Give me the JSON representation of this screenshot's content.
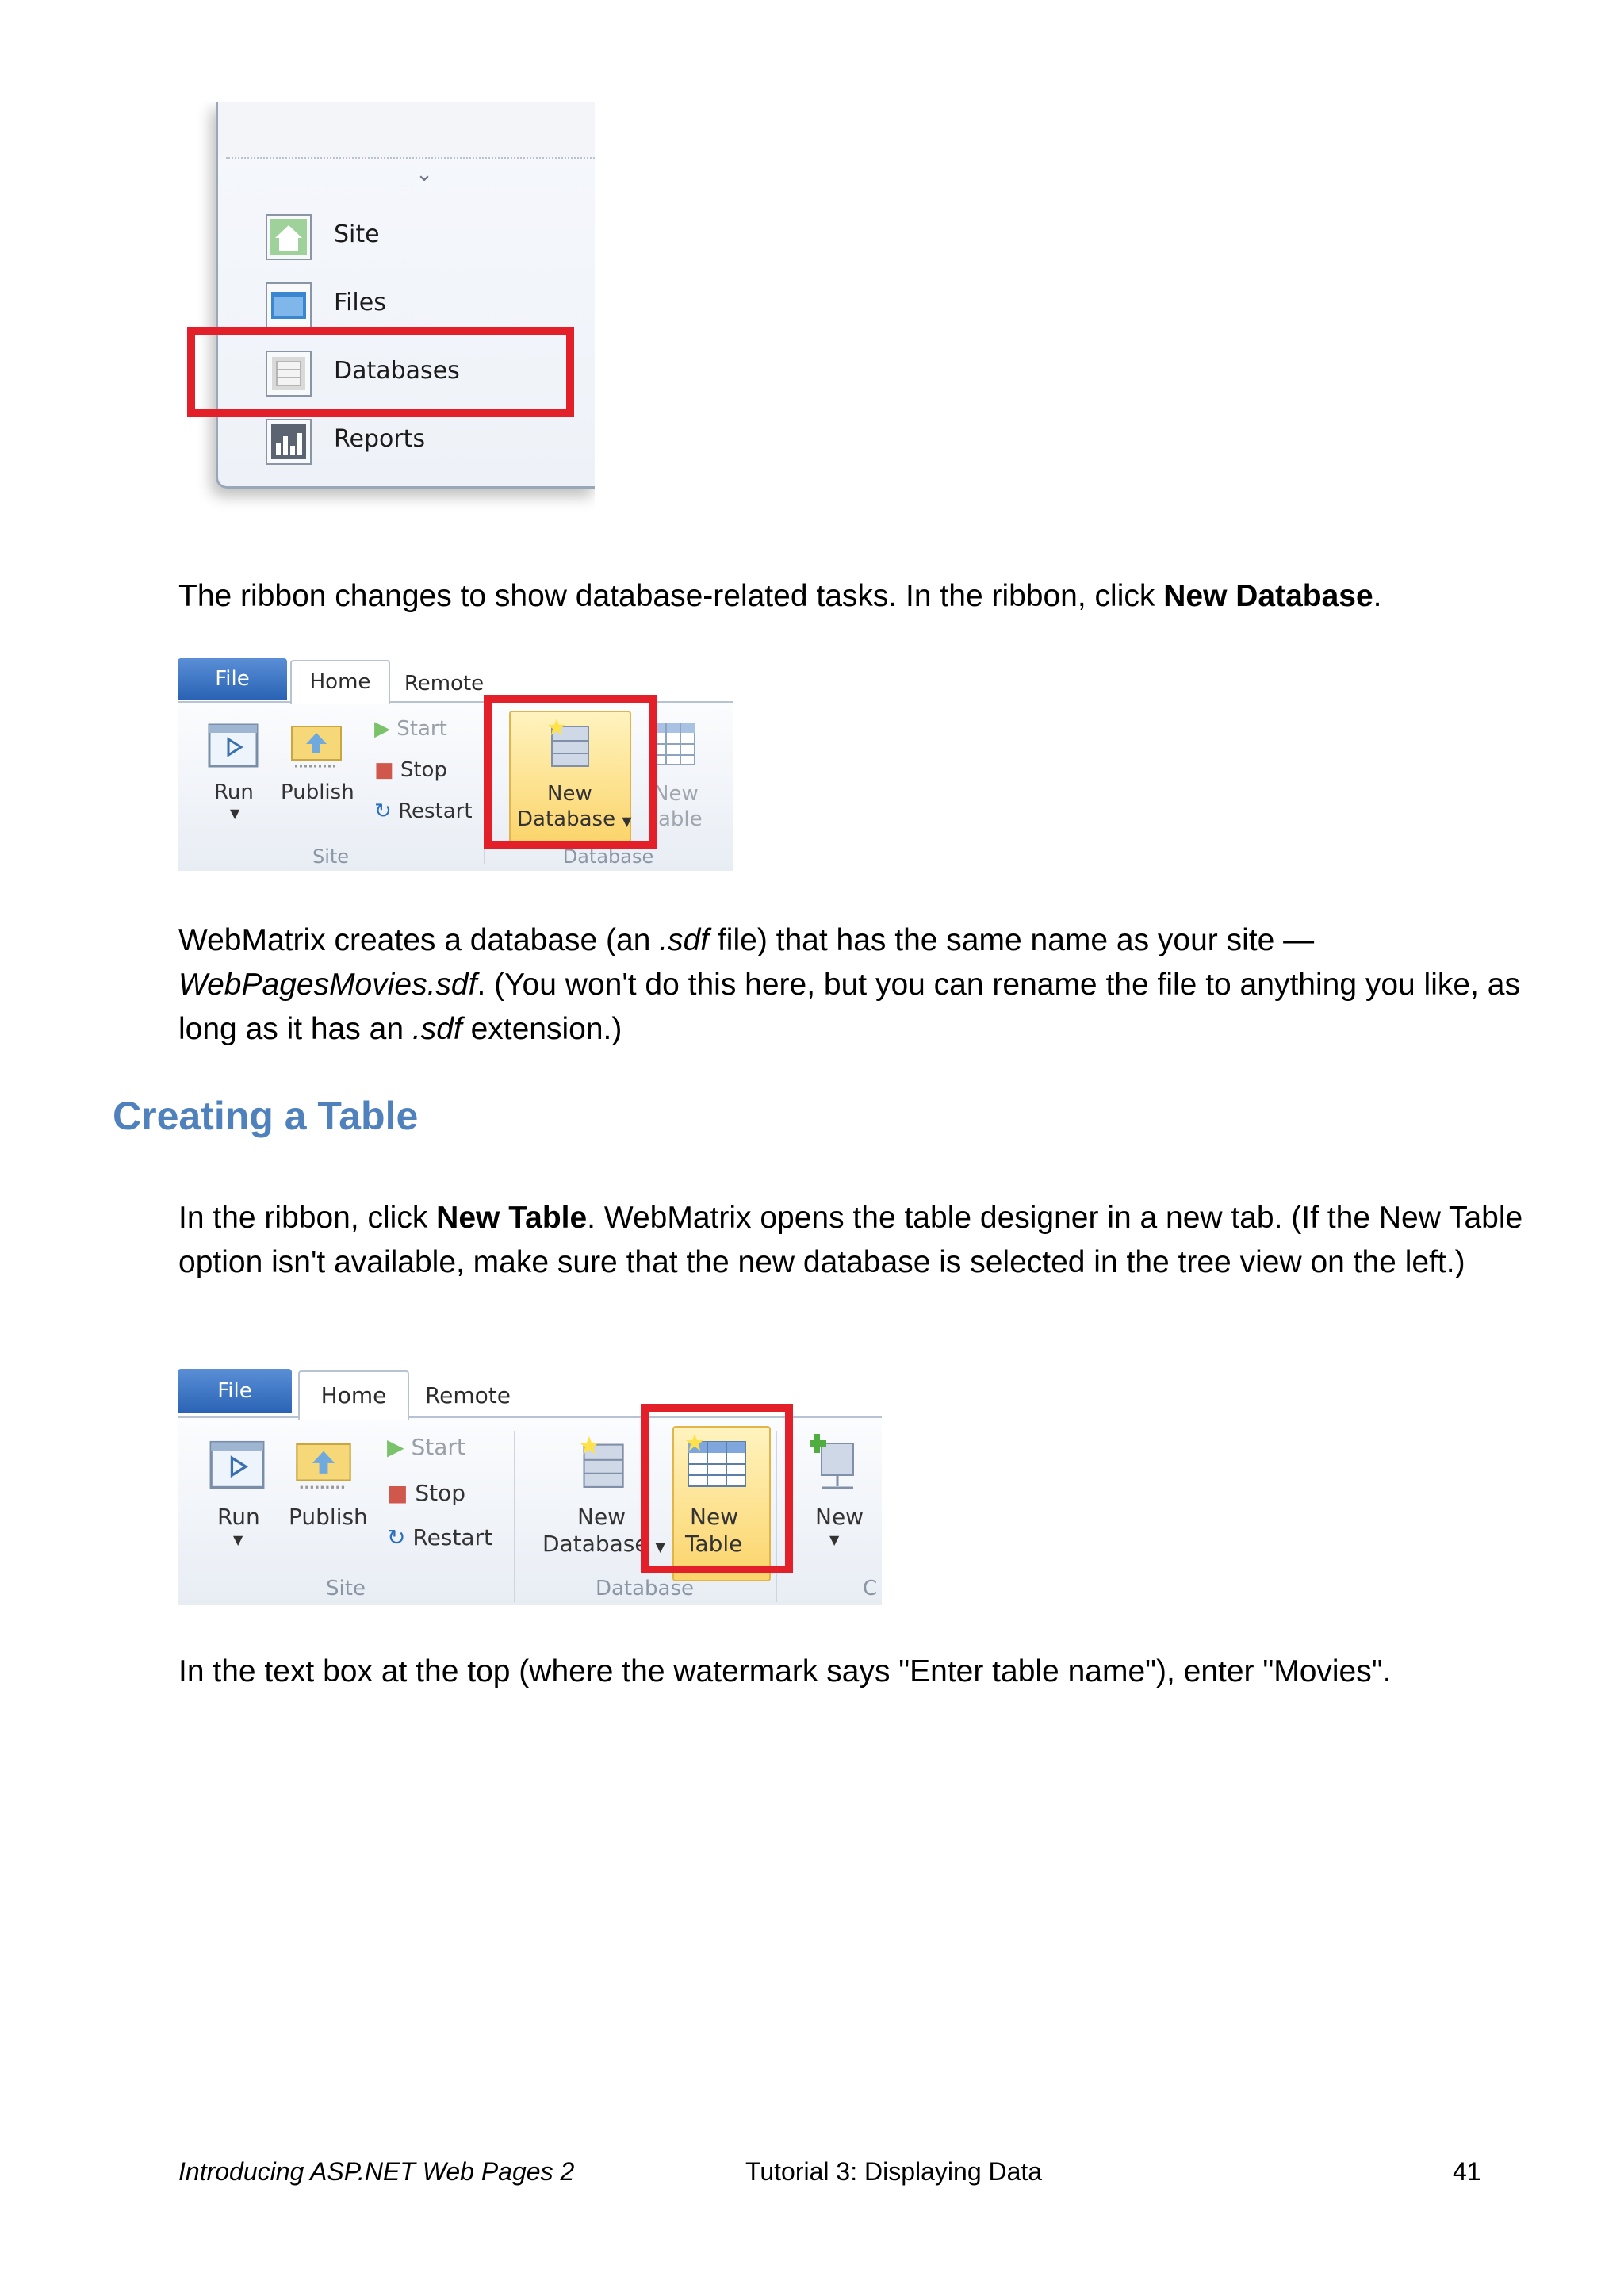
{
  "nav_screenshot": {
    "items": [
      {
        "label": "Site"
      },
      {
        "label": "Files"
      },
      {
        "label": "Databases"
      },
      {
        "label": "Reports"
      }
    ],
    "highlight_color": "#e3202a"
  },
  "para1": {
    "text": "The ribbon changes to show database-related tasks. In the ribbon, click ",
    "bold": "New Database",
    "end": "."
  },
  "ribbon1": {
    "tabs": {
      "file": "File",
      "home": "Home",
      "remote": "Remote"
    },
    "commands": {
      "run": "Run",
      "publish": "Publish",
      "start": "Start",
      "stop": "Stop",
      "restart": "Restart",
      "new_database_1": "New",
      "new_database_2": "Database",
      "new_table_partial_1": "New",
      "new_table_partial_2": "able"
    },
    "groups": {
      "site": "Site",
      "database": "Database"
    }
  },
  "para2": {
    "t1": "WebMatrix creates a database (an ",
    "i1": ".sdf",
    "t2": " file) that has the same name as your site — ",
    "i2": "WebPagesMovies.sdf",
    "t3": ". (You won't do this here, but you can rename the file to anything you like, as long as it has an ",
    "i3": ".sdf",
    "t4": " extension.)"
  },
  "heading": "Creating a Table",
  "para3": {
    "t1": "In the ribbon, click ",
    "bold": "New Table",
    "t2": ". WebMatrix opens the table designer in a new tab. (If the New Table option isn't available, make sure that the new database is selected in the tree view on the left.)"
  },
  "ribbon2": {
    "tabs": {
      "file": "File",
      "home": "Home",
      "remote": "Remote"
    },
    "commands": {
      "run": "Run",
      "publish": "Publish",
      "start": "Start",
      "stop": "Stop",
      "restart": "Restart",
      "new_database_1": "New",
      "new_database_2": "Database",
      "new_table_1": "New",
      "new_table_2": "Table",
      "new_conn": "New"
    },
    "groups": {
      "site": "Site",
      "database": "Database",
      "cut": "C"
    }
  },
  "para4": {
    "text": "In the text box at the top (where the watermark says \"Enter table name\"), enter \"Movies\"."
  },
  "footer": {
    "left": "Introducing ASP.NET Web Pages 2",
    "center": "Tutorial 3: Displaying Data",
    "page": "41"
  }
}
